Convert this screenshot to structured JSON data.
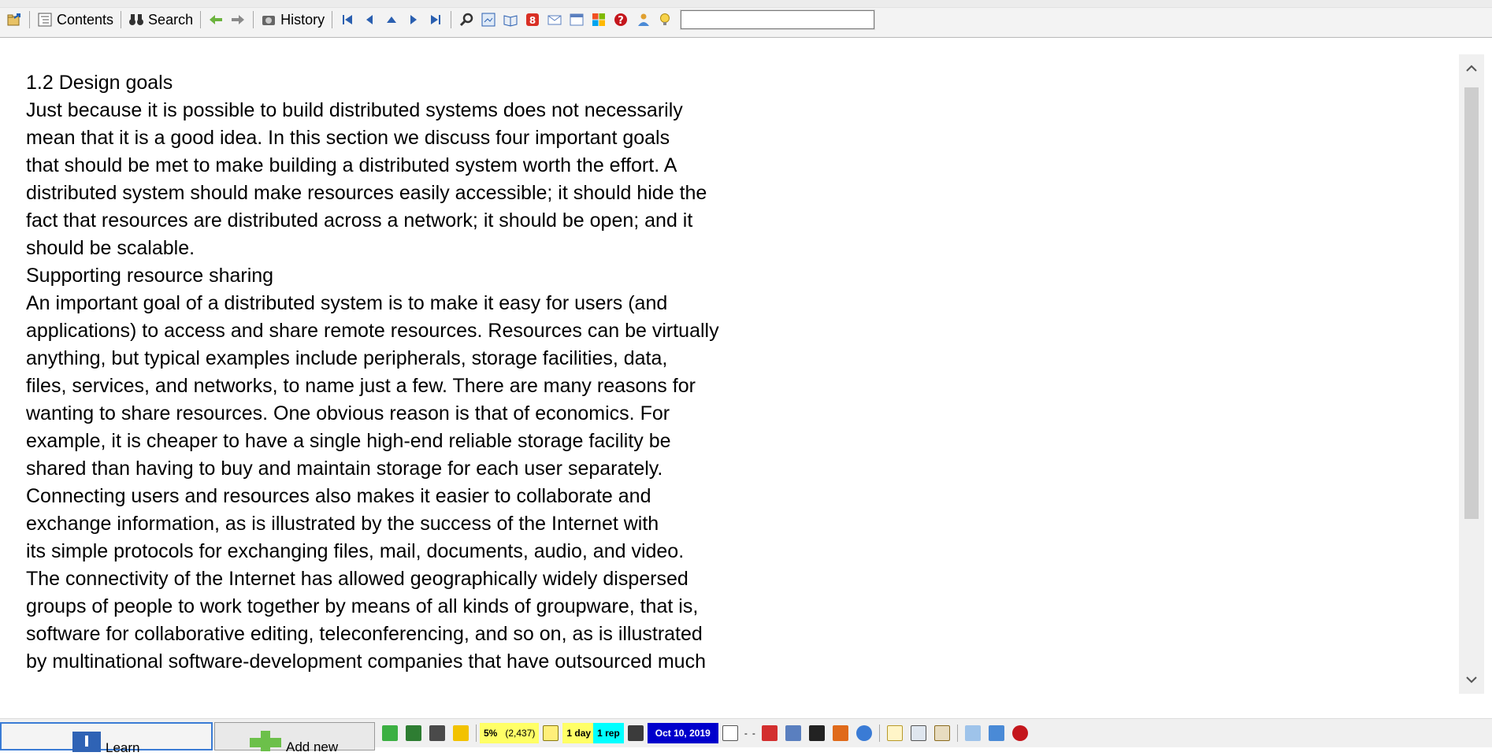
{
  "toolbar": {
    "contents_label": "Contents",
    "search_label": "Search",
    "history_label": "History",
    "search_value": ""
  },
  "document": {
    "paragraphs": [
      "1.2 Design goals",
      "Just because it is possible to build distributed systems does not necessarily",
      "mean that it is a good idea. In this section we discuss four important goals",
      "that should be met to make building a distributed system worth the effort. A",
      "distributed system should make resources easily accessible; it should hide the",
      "fact that resources are distributed across a network; it should be open; and it",
      "should be scalable.",
      "Supporting resource sharing",
      "An important goal of a distributed system is to make it easy for users (and",
      "applications) to access and share remote resources. Resources can be virtually",
      "anything, but typical examples include peripherals, storage facilities, data,",
      "files, services, and networks, to name just a few. There are many reasons for",
      "wanting to share resources. One obvious reason is that of economics. For",
      "example, it is cheaper to have a single high-end reliable storage facility be",
      "shared than having to buy and maintain storage for each user separately.",
      "Connecting users and resources also makes it easier to collaborate and",
      "exchange information, as is illustrated by the success of the Internet with",
      "its simple protocols for exchanging files, mail, documents, audio, and video.",
      "The connectivity of the Internet has allowed geographically widely dispersed",
      "groups of people to work together by means of all kinds of groupware, that is,",
      "software for collaborative editing, teleconferencing, and so on, as is illustrated",
      "by multinational software-development companies that have outsourced much"
    ]
  },
  "bottom": {
    "learn_label": "Learn",
    "add_new_label": "Add new",
    "progress_percent": "5%",
    "count": "(2,437)",
    "interval": "1 day",
    "reps": "1 rep",
    "date": "Oct 10, 2019",
    "dash1": "-",
    "dash2": "-"
  },
  "colors": {
    "yellow": "#ffff66",
    "cyan": "#00ffff",
    "date_bg": "#0000cc",
    "date_fg": "#ffffff",
    "learn_accent": "#3a7bd5"
  },
  "icons": [
    "open-folder-icon",
    "contents-icon",
    "binoculars-icon",
    "back-arrow-icon",
    "forward-arrow-icon",
    "camera-icon",
    "first-icon",
    "previous-icon",
    "up-icon",
    "next-icon",
    "last-icon",
    "magnifier-icon",
    "image-icon",
    "book-icon",
    "google-icon",
    "mail-icon",
    "window-icon",
    "windows-logo-icon",
    "help-icon",
    "person-icon",
    "bulb-icon"
  ]
}
